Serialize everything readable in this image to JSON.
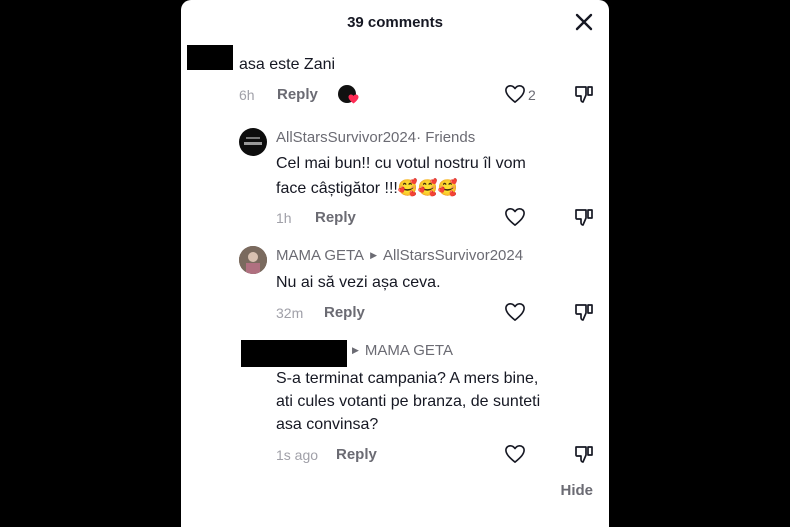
{
  "header": {
    "title": "39 comments"
  },
  "comments": [
    {
      "text": "asa este Zani",
      "time": "6h",
      "reply_label": "Reply",
      "like_count": "2"
    },
    {
      "author": "AllStarsSurvivor2024",
      "badge": " · Friends",
      "text_line1": "Cel mai bun!! cu votul nostru îl vom",
      "text_line2": "face câștigător !!!",
      "emoji": "🥰🥰🥰",
      "time": "1h",
      "reply_label": "Reply"
    },
    {
      "author": "MAMA GETA",
      "reply_to": "AllStarsSurvivor2024",
      "text": "Nu ai să vezi așa ceva.",
      "time": "32m",
      "reply_label": "Reply"
    },
    {
      "reply_to": "MAMA GETA",
      "text_line1": "S-a terminat campania? A mers bine,",
      "text_line2": "ati cules votanti pe branza, de sunteti",
      "text_line3": "asa convinsa?",
      "time": "1s ago",
      "reply_label": "Reply"
    }
  ],
  "footer": {
    "hide_label": "Hide"
  }
}
